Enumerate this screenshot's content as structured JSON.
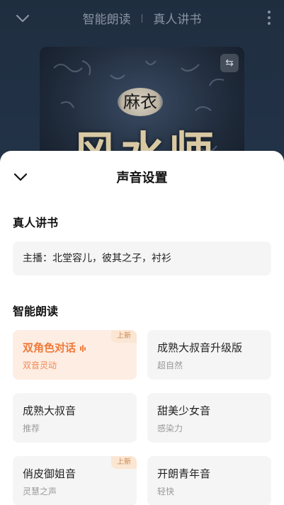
{
  "header": {
    "tab_ai": "智能朗读",
    "tab_human": "真人讲书"
  },
  "cover": {
    "seal_text": "麻衣",
    "title_text": "风水师"
  },
  "sheet": {
    "title": "声音设置",
    "section_human": "真人讲书",
    "human_anchors": "主播：北堂容儿，彼其之子，衬衫",
    "section_ai": "智能朗读",
    "voices": [
      {
        "name": "双角色对话",
        "sub": "双音灵动",
        "badge": "上新",
        "selected": true
      },
      {
        "name": "成熟大叔音升级版",
        "sub": "超自然",
        "badge": "",
        "selected": false
      },
      {
        "name": "成熟大叔音",
        "sub": "推荐",
        "badge": "",
        "selected": false
      },
      {
        "name": "甜美少女音",
        "sub": "感染力",
        "badge": "",
        "selected": false
      },
      {
        "name": "俏皮御姐音",
        "sub": "灵慧之声",
        "badge": "上新",
        "selected": false
      },
      {
        "name": "开朗青年音",
        "sub": "轻快",
        "badge": "",
        "selected": false
      }
    ]
  },
  "colors": {
    "accent": "#ef7a3a",
    "selected_bg": "#fdede3",
    "badge_text": "#c9884f"
  }
}
